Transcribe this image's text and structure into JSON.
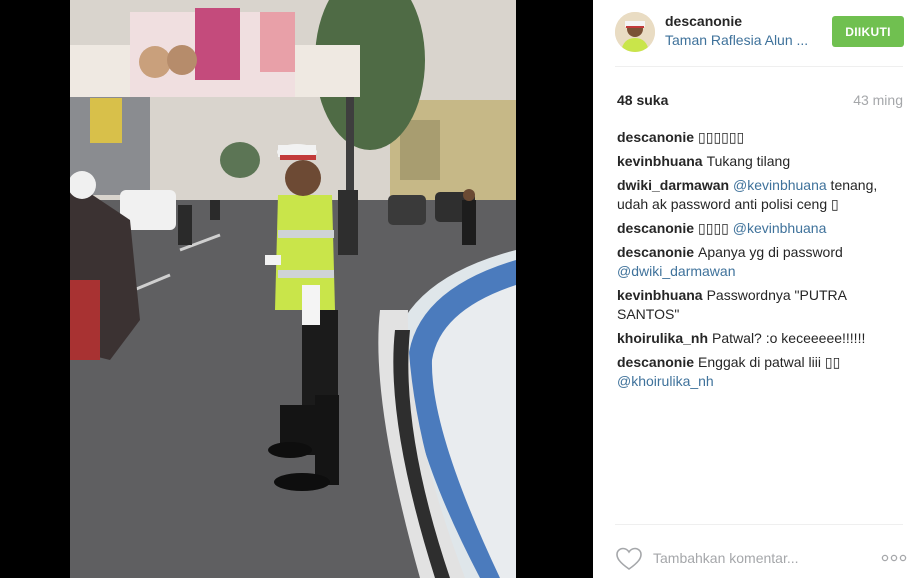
{
  "photo": {
    "alt": ""
  },
  "header": {
    "username": "descanonie",
    "location": "Taman Raflesia Alun ...",
    "follow_label": "DIIKUTI"
  },
  "stats": {
    "likes": "48 suka",
    "time": "43 ming"
  },
  "comments": [
    {
      "user": "descanonie",
      "parts": [
        {
          "text": "▯▯▯▯▯▯",
          "mention": false
        }
      ]
    },
    {
      "user": "kevinbhuana",
      "parts": [
        {
          "text": "Tukang tilang",
          "mention": false
        }
      ]
    },
    {
      "user": "dwiki_darmawan",
      "parts": [
        {
          "text": "@kevinbhuana",
          "mention": true
        },
        {
          "text": " tenang, udah ak password anti polisi ceng ▯",
          "mention": false
        }
      ]
    },
    {
      "user": "descanonie",
      "parts": [
        {
          "text": "▯▯▯▯ ",
          "mention": false
        },
        {
          "text": "@kevinbhuana",
          "mention": true
        }
      ]
    },
    {
      "user": "descanonie",
      "parts": [
        {
          "text": "Apanya yg di password ",
          "mention": false
        },
        {
          "text": "@dwiki_darmawan",
          "mention": true
        }
      ]
    },
    {
      "user": "kevinbhuana",
      "parts": [
        {
          "text": "Passwordnya \"PUTRA SANTOS\"",
          "mention": false
        }
      ]
    },
    {
      "user": "khoirulika_nh",
      "parts": [
        {
          "text": "Patwal? :o keceeeee!!!!!!",
          "mention": false
        }
      ]
    },
    {
      "user": "descanonie",
      "parts": [
        {
          "text": "Enggak di patwal liii ▯▯ ",
          "mention": false
        },
        {
          "text": "@khoirulika_nh",
          "mention": true
        }
      ]
    }
  ],
  "footer": {
    "comment_placeholder": "Tambahkan komentar...",
    "like_icon": "heart-icon",
    "more_icon": "more-options-icon"
  },
  "colors": {
    "follow_button": "#70c050",
    "link": "#3f729b",
    "muted": "#a5a7aa",
    "text": "#262626"
  }
}
